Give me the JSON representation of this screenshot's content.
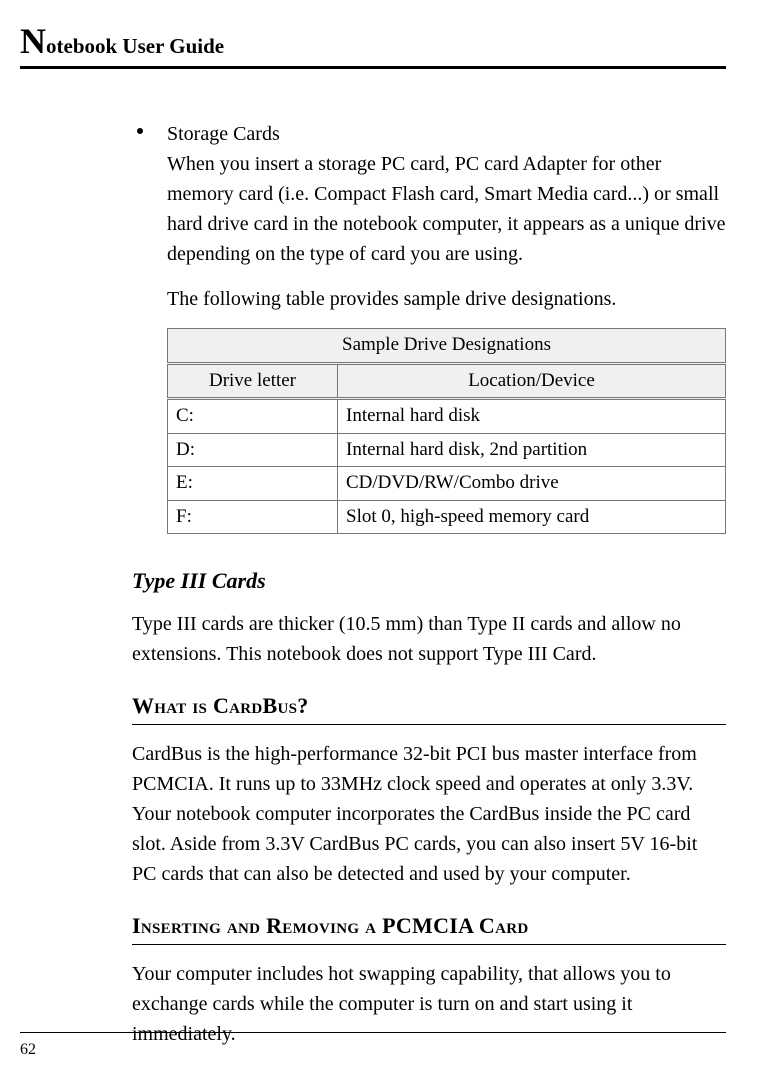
{
  "header": {
    "title_dropcap": "N",
    "title_rest": "otebook User Guide"
  },
  "bullet": {
    "heading": "Storage Cards",
    "body": "When you insert a storage PC card, PC card Adapter for other memory card (i.e. Compact Flash card, Smart Media card...) or small hard drive card in the notebook computer, it appears as a unique drive depending on the type of card you are using."
  },
  "table_intro": "The following table provides sample drive designations.",
  "chart_data": {
    "type": "table",
    "title": "Sample Drive Designations",
    "columns": [
      "Drive letter",
      "Location/Device"
    ],
    "rows": [
      [
        "C:",
        "Internal hard disk"
      ],
      [
        "D:",
        "Internal hard disk, 2nd partition"
      ],
      [
        "E:",
        "CD/DVD/RW/Combo drive"
      ],
      [
        "F:",
        "Slot 0, high-speed memory card"
      ]
    ]
  },
  "type3": {
    "heading": "Type III Cards",
    "body": "Type III cards are thicker (10.5 mm) than Type II cards and allow no extensions. This notebook does not support Type III Card."
  },
  "cardbus": {
    "heading": "What is CardBus?",
    "body": "CardBus is the high-performance 32-bit PCI bus master interface from PCMCIA. It runs up to 33MHz clock speed and operates at only 3.3V. Your notebook computer incorporates the CardBus inside the PC card slot. Aside from 3.3V CardBus PC cards, you can also insert 5V 16-bit PC cards that can also be detected and used by your computer."
  },
  "inserting": {
    "heading": "Inserting and Removing a PCMCIA Card",
    "body": "Your computer includes hot swapping capability, that allows you to exchange cards while the computer is turn on and start using it immediately."
  },
  "footer": {
    "page_number": "62"
  }
}
